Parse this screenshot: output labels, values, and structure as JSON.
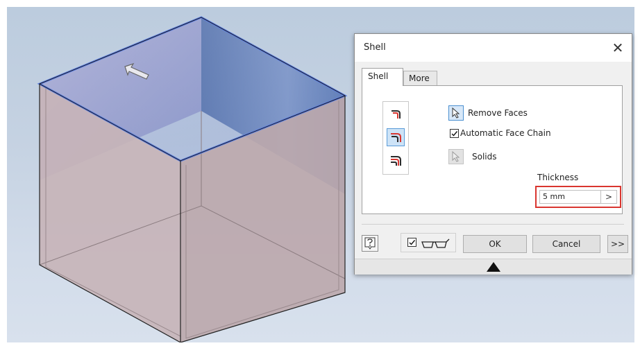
{
  "dialog": {
    "title": "Shell",
    "close_glyph": "✕",
    "tabs": [
      {
        "label": "Shell",
        "active": true
      },
      {
        "label": "More",
        "active": false
      }
    ],
    "direction_buttons": [
      {
        "icon": "shell-inside-icon",
        "active": false
      },
      {
        "icon": "shell-outside-icon",
        "active": true
      },
      {
        "icon": "shell-both-sides-icon",
        "active": false
      }
    ],
    "remove_faces": {
      "icon": "select-cursor-icon",
      "label": "Remove Faces"
    },
    "automatic_face_chain": {
      "label": "Automatic Face Chain",
      "checked": true
    },
    "solids": {
      "icon": "select-cursor-icon",
      "label": "Solids"
    },
    "thickness": {
      "label": "Thickness",
      "value": "5 mm",
      "arrow": ">"
    },
    "footer": {
      "help_icon": "help-icon",
      "preview_checked": true,
      "preview_icon": "glasses-icon",
      "ok_label": "OK",
      "cancel_label": "Cancel",
      "expand_label": ">>"
    }
  },
  "colors": {
    "highlight_red": "#d9352f",
    "selection_blue": "#4a8fd0",
    "viewport_bg": "#c5d2e2"
  }
}
